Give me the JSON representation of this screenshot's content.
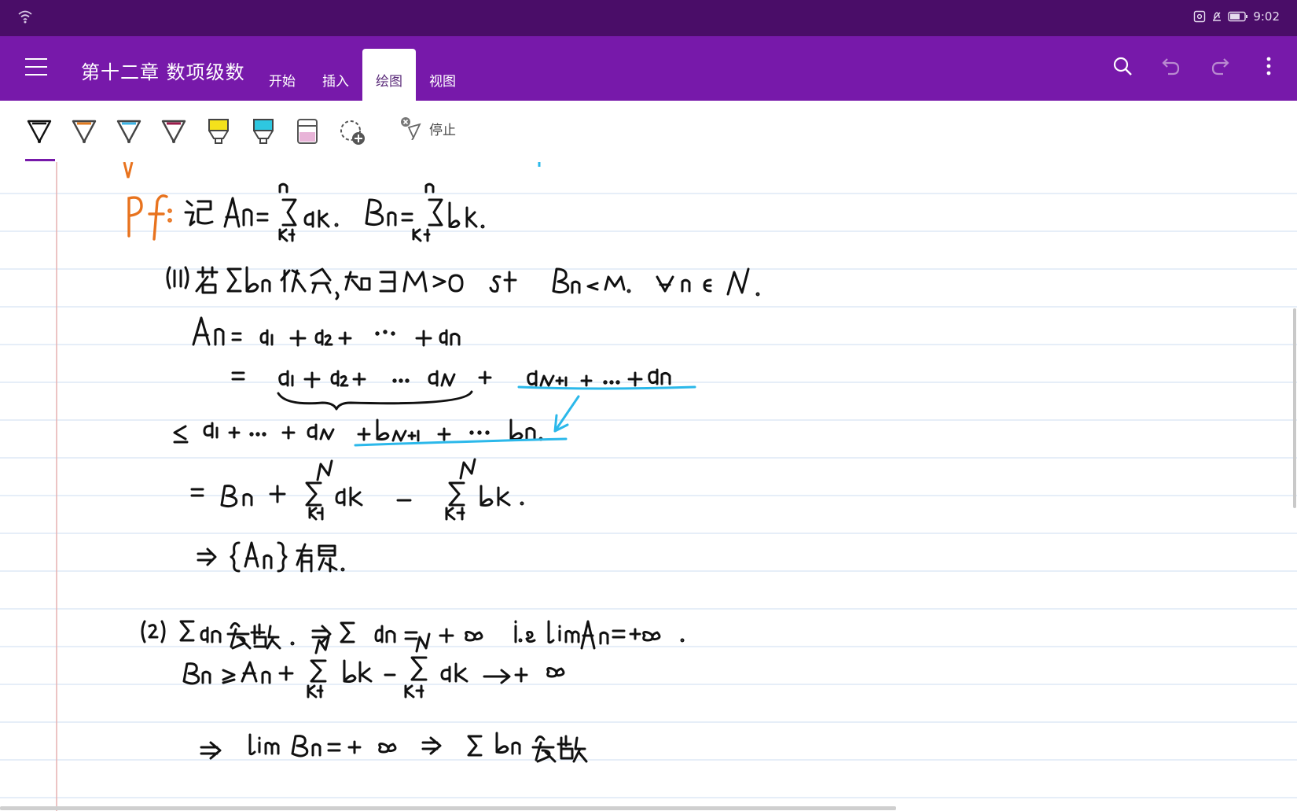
{
  "status_bar": {
    "time": "9:02"
  },
  "app_bar": {
    "title": "第十二章 数项级数",
    "tabs": [
      {
        "label": "开始",
        "active": false
      },
      {
        "label": "插入",
        "active": false
      },
      {
        "label": "绘图",
        "active": true
      },
      {
        "label": "视图",
        "active": false
      }
    ],
    "actions": [
      "search-icon",
      "undo-icon",
      "redo-icon",
      "more-icon"
    ]
  },
  "toolbar": {
    "pens": [
      {
        "name": "black-pen",
        "color": "#1a1a1a"
      },
      {
        "name": "orange-pen",
        "color": "#e07a1f"
      },
      {
        "name": "cyan-pen",
        "color": "#3bb4e6"
      },
      {
        "name": "maroon-pen",
        "color": "#9a1b4a"
      },
      {
        "name": "yellow-highlighter",
        "color": "#f4e11c"
      },
      {
        "name": "cyan-highlighter",
        "color": "#2ec7e0"
      },
      {
        "name": "pink-highlighter",
        "color": "#e8b4d8"
      }
    ],
    "stop_label": "停止"
  },
  "colors": {
    "status_bar": "#4a0d68",
    "app_bar": "#7719aa",
    "ink_black": "#111111",
    "ink_orange": "#e8731e",
    "ink_cyan": "#2bb8ea",
    "rule_line": "#d6e4f3",
    "margin_line": "#e7b5b5"
  },
  "note": {
    "lines": [
      "Pf: 记 An = Σ(k=1..n) ak, Bn = Σ(k=1..n) bk.",
      "(1) 若 Σbn 收敛, 知 ∃ M>0 s.t. Bn < M. ∀ n ∈ N.",
      "An = a1 + a2 + ··· + an",
      "= a1 + a2 + ··· aN + aN+1 + ··· + an",
      "≤ a1 + ··· + aN + bN+1 + ··· bn.",
      "= Bn + Σ(k=1..N) ak − Σ(k=1..N) bk.",
      "⇒ {An} 有界.",
      "(2) Σan 发散. ⇒ Σan = +∞ i.e lim An = +∞.",
      "Bn ≥ An + Σ(k=1..N) bk − Σ(k=1..N) ak → +∞",
      "⇒ lim Bn = +∞ ⇒ Σbn 发散"
    ]
  }
}
